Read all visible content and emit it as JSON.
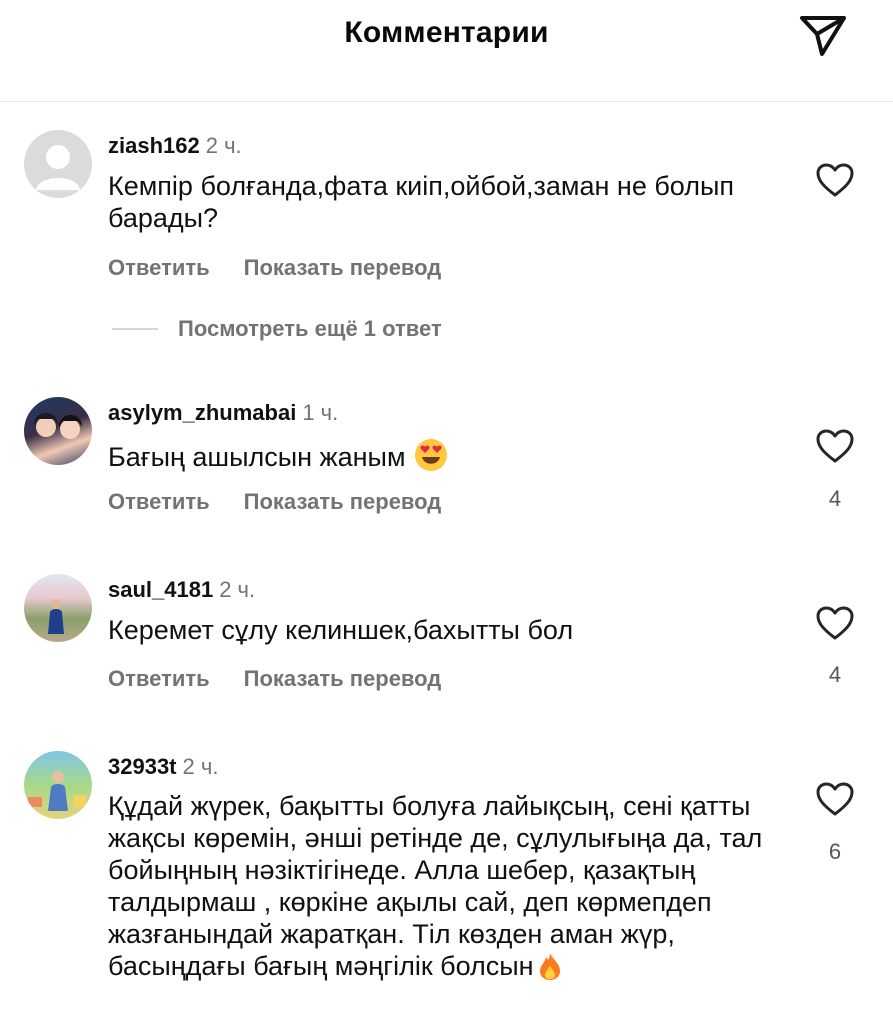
{
  "header": {
    "title": "Комментарии",
    "send_icon": "paper-plane-icon"
  },
  "actions": {
    "reply": "Ответить",
    "translate": "Показать перевод"
  },
  "view_replies": "Посмотреть ещё 1 ответ",
  "comments": [
    {
      "user": "ziash162",
      "time": "2 ч.",
      "text": "Кемпір болғанда,фата киіп,ойбой,заман не болып барады?",
      "likes": "",
      "avatar": "default-avatar"
    },
    {
      "user": "asylym_zhumabai",
      "time": "1 ч.",
      "text": "Бағың ашылсын жаным",
      "emoji": "heart-eyes-emoji",
      "likes": "4",
      "avatar": "photo-avatar"
    },
    {
      "user": "saul_4181",
      "time": "2 ч.",
      "text": "Керемет сұлу келиншек,бахытты бол",
      "likes": "4",
      "avatar": "photo-avatar"
    },
    {
      "user": "32933t",
      "time": "2 ч.",
      "text": "Құдай жүрек, бақытты болуға лайықсың, сені қатты жақсы көремін, әнші ретінде де, сұлулығыңа да, тал бойыңның нәзіктігінеде. Алла шебер, қазақтың талдырмаш , көркіне ақылы сай, деп көрмепдеп жазғанындай жаратқан. Тіл көзден аман жүр, басыңдағы бағың мәңгілік болсын",
      "emoji": "fire-emoji",
      "likes": "6",
      "avatar": "photo-avatar"
    }
  ],
  "colors": {
    "secondary_text": "#737373",
    "divider": "#e8e8e8",
    "emoji_yellow": "#ffc83d",
    "emoji_heart": "#e8264b",
    "fire": "#ff7a1a"
  }
}
